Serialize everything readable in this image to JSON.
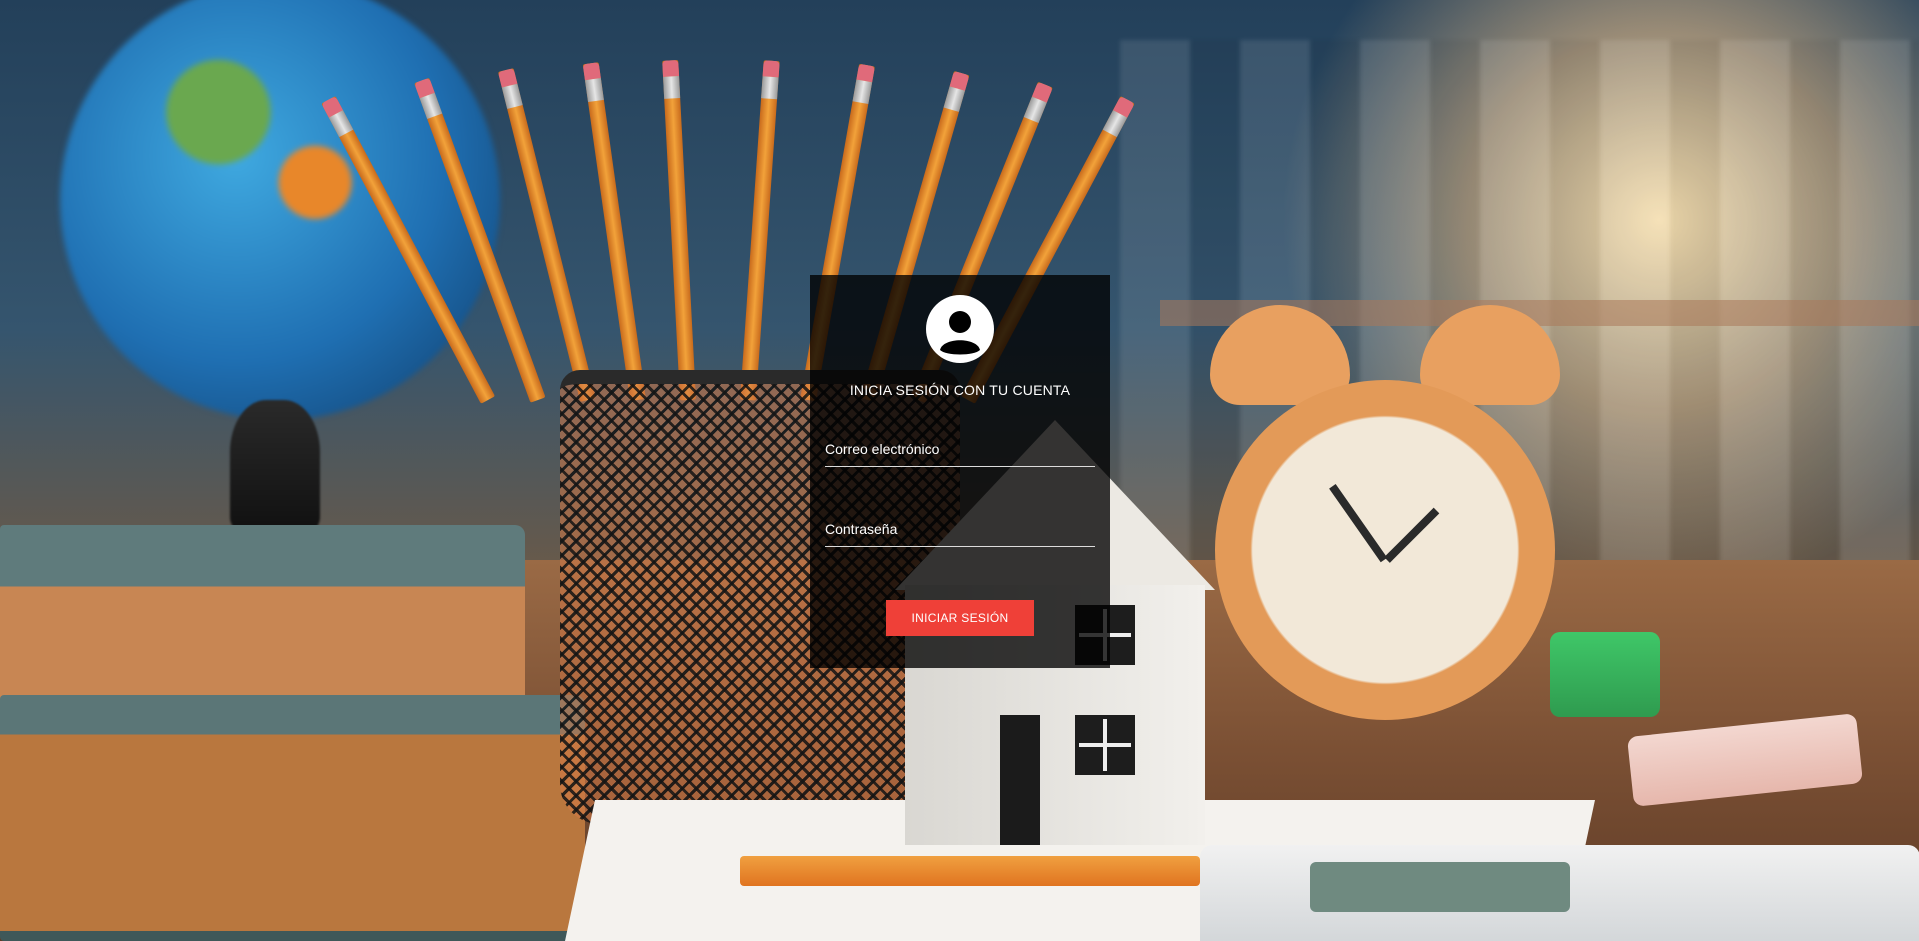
{
  "login": {
    "title": "INICIA SESIÓN CON TU CUENTA",
    "email_placeholder": "Correo electrónico",
    "password_placeholder": "Contraseña",
    "submit_label": "INICIAR SESIÓN",
    "avatar_icon": "user-circle-icon"
  },
  "colors": {
    "button": "#ef4038",
    "card_overlay": "rgba(0,0,0,0.78)",
    "text": "#ffffff"
  },
  "background": {
    "description_icons": [
      "globe",
      "pencils",
      "pencil-cup",
      "house-model",
      "alarm-clock",
      "books",
      "calculator",
      "eraser"
    ]
  }
}
